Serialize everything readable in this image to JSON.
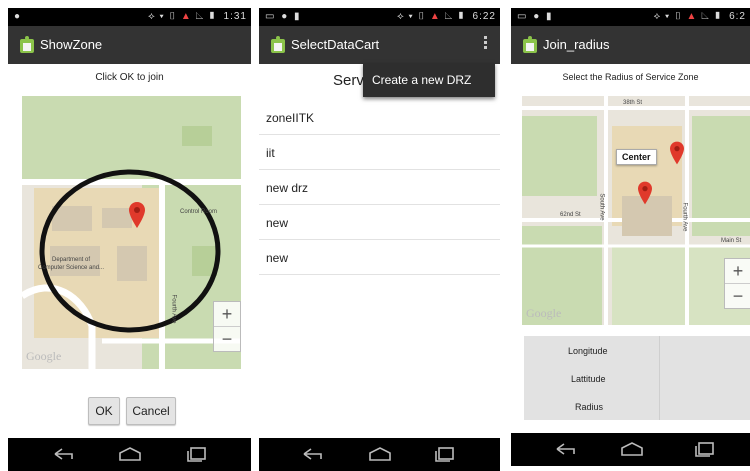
{
  "status_bars": {
    "one": {
      "left": "●",
      "time": "1:31"
    },
    "two": {
      "left": "▭ ● ▮",
      "time": "6:22"
    },
    "three": {
      "left": "▭ ● ▮",
      "time": "6:2"
    }
  },
  "screen_showzone": {
    "title": "ShowZone",
    "prompt": "Click OK to join",
    "map_labels": {
      "building": "Department of\nComputer Science and...",
      "control_room": "Control Room",
      "street": "Fourth Ave",
      "google": "Google"
    },
    "ok_label": "OK",
    "cancel_label": "Cancel"
  },
  "screen_select": {
    "title": "SelectDataCart",
    "header_partial": "Serv",
    "menu_item": "Create a new DRZ",
    "rows": [
      "zoneIITK",
      "iit",
      "new drz",
      "new",
      "new"
    ]
  },
  "screen_radius": {
    "title": "Join_radius",
    "prompt": "Select the Radius of Service Zone",
    "center_label": "Center",
    "map_labels": {
      "street_top": "38th St",
      "south_ave": "South Ave",
      "st62": "62nd St",
      "fourth_ave": "Fourth Ave",
      "main_st": "Main St",
      "google": "Google"
    },
    "fields": {
      "longitude": "Longitude",
      "latitude": "Lattitude",
      "radius": "Radius"
    }
  },
  "colors": {
    "actionbar": "#333333",
    "map_bg": "#e9e5dc",
    "park": "#c9dbb1",
    "campus": "#e8d9b5",
    "marker": "#e0392b",
    "ring": "#111111"
  },
  "zoom": {
    "plus": "+",
    "minus": "−"
  }
}
